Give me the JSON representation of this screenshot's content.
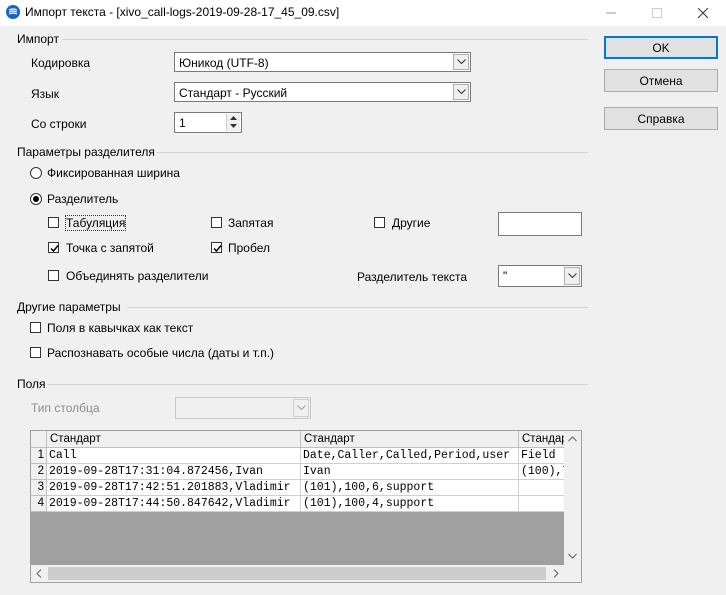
{
  "window": {
    "title": "Импорт текста - [xivo_call-logs-2019-09-28-17_45_09.csv]"
  },
  "import": {
    "section": "Импорт",
    "encoding_label": "Кодировка",
    "encoding_value": "Юникод (UTF-8)",
    "language_label": "Язык",
    "language_value": "Стандарт - Русский",
    "from_row_label": "Со строки",
    "from_row_value": "1"
  },
  "separator": {
    "section": "Параметры разделителя",
    "fixed_width": "Фиксированная ширина",
    "separated_by": "Разделитель",
    "tab": "Табуляция",
    "comma": "Запятая",
    "other": "Другие",
    "semicolon": "Точка с запятой",
    "space": "Пробел",
    "merge": "Объединять разделители",
    "text_delimiter_label": "Разделитель текста",
    "text_delimiter_value": "\"",
    "other_value": ""
  },
  "other_options": {
    "section": "Другие параметры",
    "quoted_as_text": "Поля в кавычках как текст",
    "detect_special": "Распознавать особые числа (даты и т.п.)"
  },
  "fields": {
    "section": "Поля",
    "column_type_label": "Тип столбца",
    "column_type_value": "",
    "headers": [
      "Стандарт",
      "Стандарт",
      "Стандар"
    ],
    "rows": [
      {
        "n": "1",
        "c": [
          "Call",
          "Date,Caller,Called,Period,user",
          "Field"
        ]
      },
      {
        "n": "2",
        "c": [
          "2019-09-28T17:31:04.872456,Ivan",
          "Ivan",
          "(100),7"
        ]
      },
      {
        "n": "3",
        "c": [
          "2019-09-28T17:42:51.201883,Vladimir",
          "(101),100,6,support",
          ""
        ]
      },
      {
        "n": "4",
        "c": [
          "2019-09-28T17:44:50.847642,Vladimir",
          "(101),100,4,support",
          ""
        ]
      }
    ]
  },
  "buttons": {
    "ok": "OK",
    "cancel": "Отмена",
    "help": "Справка"
  }
}
